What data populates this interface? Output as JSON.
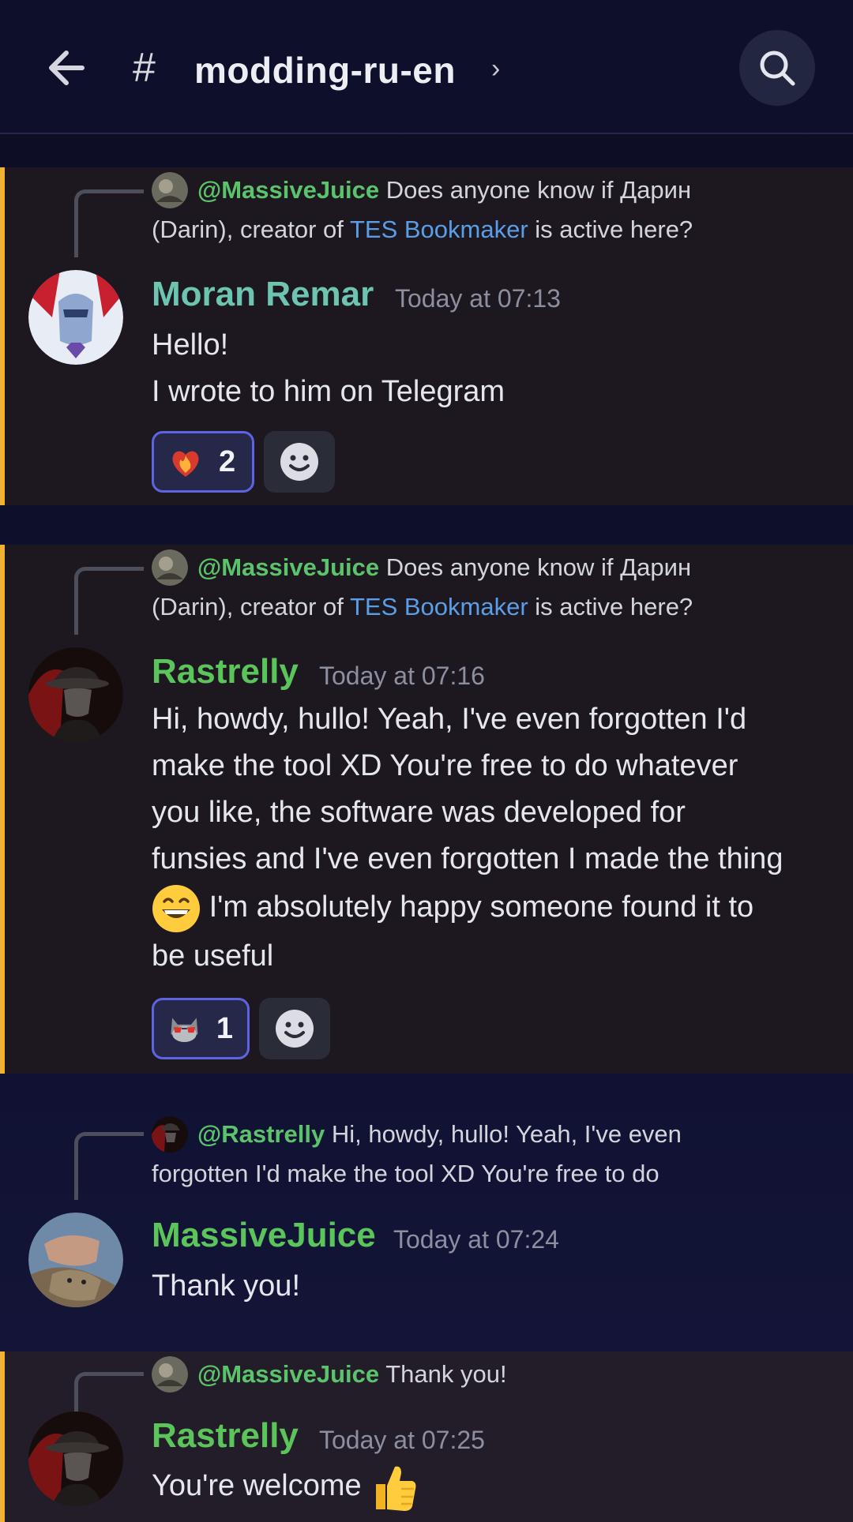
{
  "header": {
    "hash": "#",
    "channel": "modding-ru-en",
    "chevron": "›"
  },
  "messages": [
    {
      "reply": {
        "mention": "@MassiveJuice",
        "text_a": "Does anyone know if Дарин",
        "text_b": "(Darin), creator of",
        "link": "TES Bookmaker",
        "text_c": "is active here?"
      },
      "author": "Moran Remar",
      "time": "Today at 07:13",
      "lines": [
        "Hello!",
        "I wrote to him on Telegram"
      ],
      "reaction": {
        "emoji": "fire-heart",
        "count": "2"
      }
    },
    {
      "reply": {
        "mention": "@MassiveJuice",
        "text_a": "Does anyone know if Дарин",
        "text_b": "(Darin), creator of",
        "link": "TES Bookmaker",
        "text_c": "is active here?"
      },
      "author": "Rastrelly",
      "time": "Today at 07:16",
      "lines": [
        "Hi, howdy, hullo! Yeah, I've even forgotten I'd",
        "make the tool XD You're free to do whatever",
        "you like, the software was developed for",
        "funsies and I've even forgotten I made the thing",
        "I'm absolutely happy someone found it to",
        "be useful"
      ],
      "reaction": {
        "emoji": "cat-sunglasses",
        "count": "1"
      }
    },
    {
      "reply": {
        "mention": "@Rastrelly",
        "text_a": "Hi, howdy, hullo! Yeah, I've even",
        "text_b": "forgotten I'd make the tool XD You're free to do"
      },
      "author": "MassiveJuice",
      "time": "Today at 07:24",
      "lines": [
        "Thank you!"
      ]
    },
    {
      "reply": {
        "mention": "@MassiveJuice",
        "text_a": "Thank you!"
      },
      "author": "Rastrelly",
      "time": "Today at 07:25",
      "lines": [
        "You're welcome"
      ]
    }
  ],
  "colors": {
    "accent_bar": "#f0b232",
    "mention": "#5bc46a",
    "link": "#5a9ee8",
    "reaction_border": "#5e64e0"
  }
}
